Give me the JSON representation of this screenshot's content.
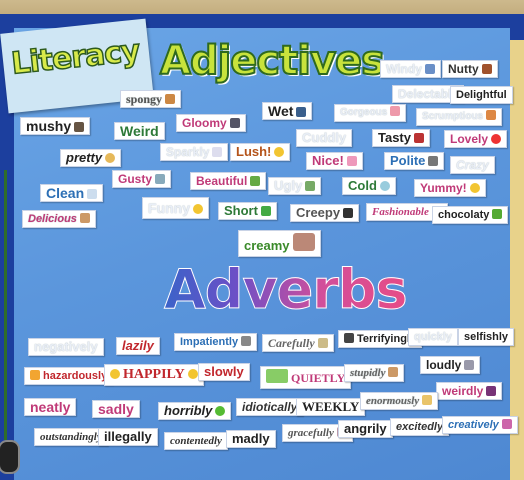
{
  "titles": {
    "literacy": "Literacy",
    "adjectives": "Adjectives",
    "adverbs": "Adverbs"
  },
  "adjectives": {
    "windy": "Windy",
    "nutty": "Nutty",
    "spongy": "spongy",
    "delectable": "Delectable",
    "delightful": "Delightful",
    "mushy": "mushy",
    "wet": "Wet",
    "gorgeous": "Gorgeous",
    "scrumptious": "Scrumptious",
    "weird": "Weird",
    "gloomy": "Gloomy",
    "cuddly": "Cuddly",
    "tasty": "Tasty",
    "lovely": "Lovely",
    "pretty": "pretty",
    "sparkly": "Sparkly",
    "lush": "Lush!",
    "nice": "Nice!",
    "polite": "Polite",
    "crazy": "Crazy",
    "clean": "Clean",
    "gusty": "Gusty",
    "beautiful": "Beautiful",
    "ugly": "Ugly",
    "cold": "Cold",
    "yummy": "Yummy!",
    "delicious": "Delicious",
    "funny": "Funny",
    "short": "Short",
    "creepy": "Creepy",
    "fashionable": "Fashionable",
    "chocolaty": "chocolaty",
    "creamy": "creamy"
  },
  "adverbs": {
    "negatively": "negatively",
    "lazily": "lazily",
    "impatiently": "Impatiently",
    "carefully": "Carefully",
    "terrifyingly": "Terrifyingly",
    "quickly": "quickly",
    "selfishly": "selfishly",
    "hazardously": "hazardously",
    "happily": "HAPPILY",
    "slowly": "slowly",
    "quietly": "QUIETLY",
    "stupidly": "stupidly",
    "loudly": "loudly",
    "weirdly": "weirdly",
    "neatly": "neatly",
    "sadly": "sadly",
    "horribly": "horribly",
    "idiotically": "idiotically",
    "weekly": "WEEKLY",
    "enormously": "enormously",
    "outstandingly": "outstandingly",
    "illegally": "illegally",
    "contentedly": "contentedly",
    "madly": "madly",
    "gracefully": "gracefully",
    "angrily": "angrily",
    "excitedly": "excitedly",
    "creatively": "creatively"
  },
  "colors": {
    "board": "#5b96dc",
    "frame": "#1c3f9e",
    "adjectives_title": "#c8e33c",
    "adverbs_title_start": "#3b63c9",
    "adverbs_title_end": "#e74c86"
  }
}
